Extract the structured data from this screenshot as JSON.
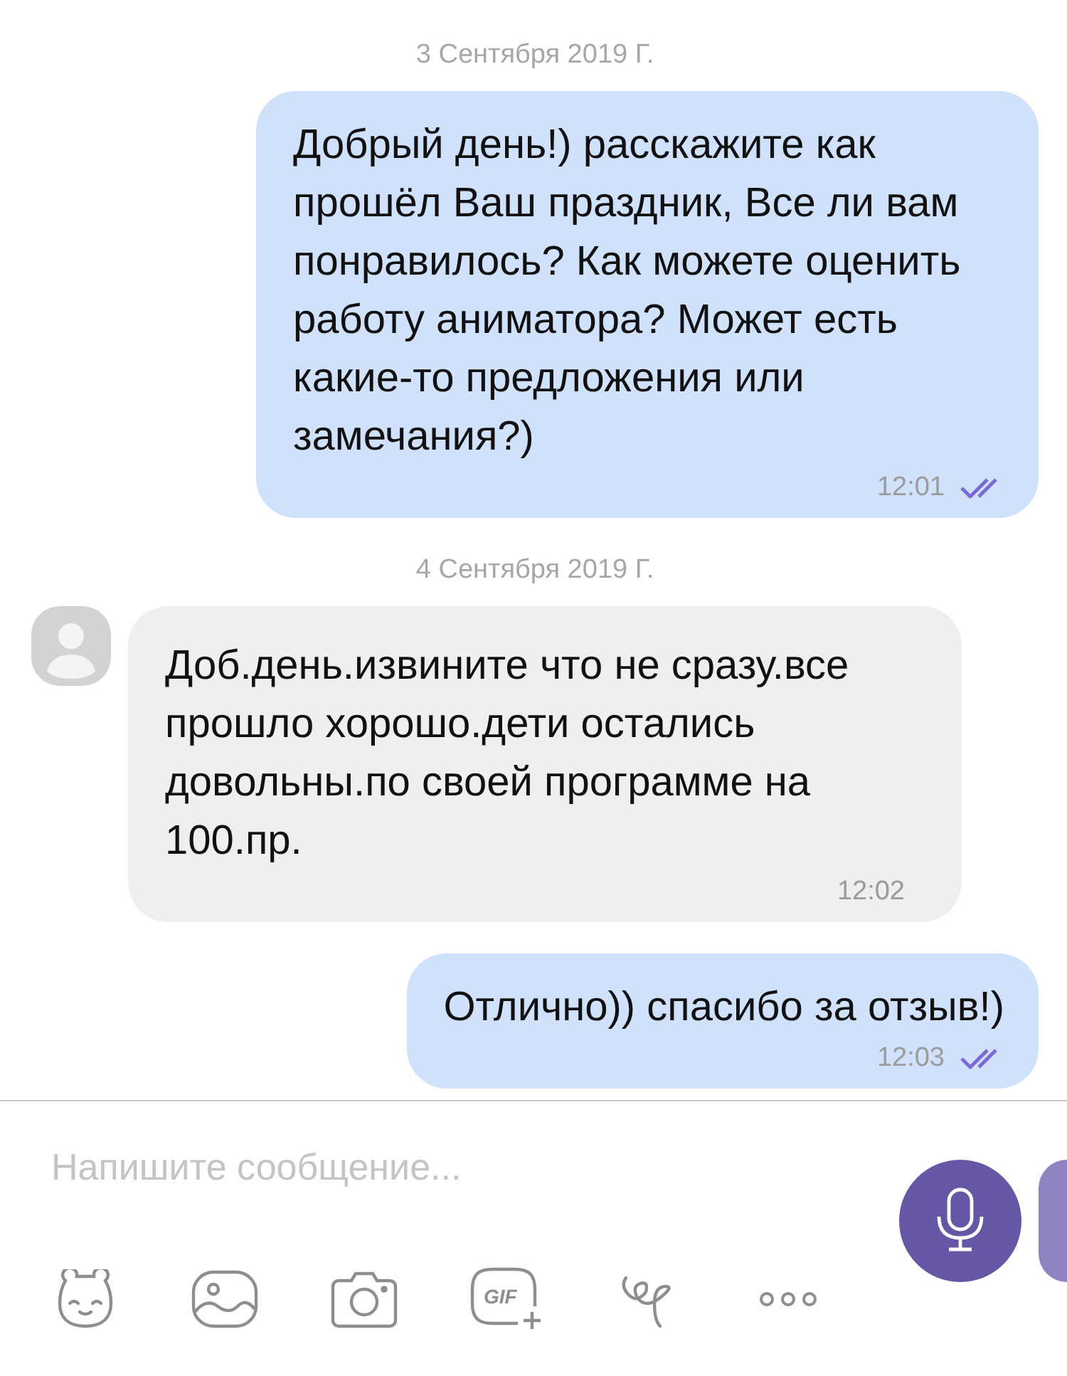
{
  "messages": [
    {
      "kind": "date",
      "text": "3 Сентября 2019 Г."
    },
    {
      "kind": "outgoing",
      "text": "Добрый день!) расскажите как прошёл Ваш праздник, Все ли вам понравилось? Как можете оценить работу аниматора? Может есть какие-то предложения или замечания?)",
      "time": "12:01",
      "read": true
    },
    {
      "kind": "date",
      "text": "4 Сентября 2019 Г."
    },
    {
      "kind": "incoming",
      "text": "Доб.день.извините что не сразу.все прошло хорошо.дети остались довольны.по своей программе на 100.пр.",
      "time": "12:02"
    },
    {
      "kind": "outgoing",
      "text": "Отлично)) спасибо за отзыв!)",
      "time": "12:03",
      "read": true
    }
  ],
  "composer": {
    "placeholder": "Напишите сообщение...",
    "gif_label": "GIF"
  }
}
